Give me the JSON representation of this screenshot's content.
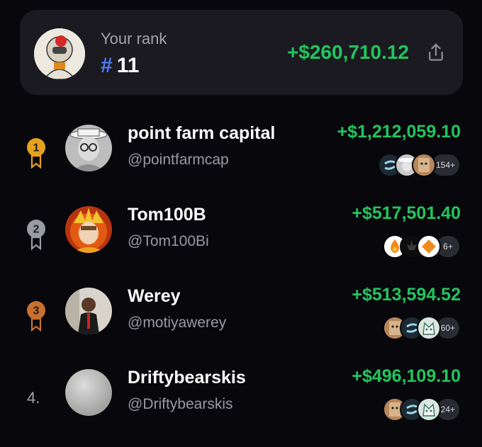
{
  "your_rank": {
    "label": "Your rank",
    "hash": "#",
    "number": "11",
    "pnl": "+$260,710.12"
  },
  "leaderboard": [
    {
      "rank": "1",
      "name": "point farm capital",
      "handle": "@pointfarmcap",
      "pnl": "+$1,212,059.10",
      "more": "154+",
      "medal_color": "#e5a21a"
    },
    {
      "rank": "2",
      "name": "Tom100B",
      "handle": "@Tom100Bi",
      "pnl": "+$517,501.40",
      "more": "6+",
      "medal_color": "#9a9aa2"
    },
    {
      "rank": "3",
      "name": "Werey",
      "handle": "@motiyawerey",
      "pnl": "+$513,594.52",
      "more": "60+",
      "medal_color": "#c8702e"
    },
    {
      "rank": "4.",
      "name": "Driftybearskis",
      "handle": "@Driftybearskis",
      "pnl": "+$496,109.10",
      "more": "24+"
    }
  ],
  "colors": {
    "positive": "#22c55e",
    "accent": "#4f7df5",
    "background": "#07070c",
    "card": "#1a1a20"
  }
}
